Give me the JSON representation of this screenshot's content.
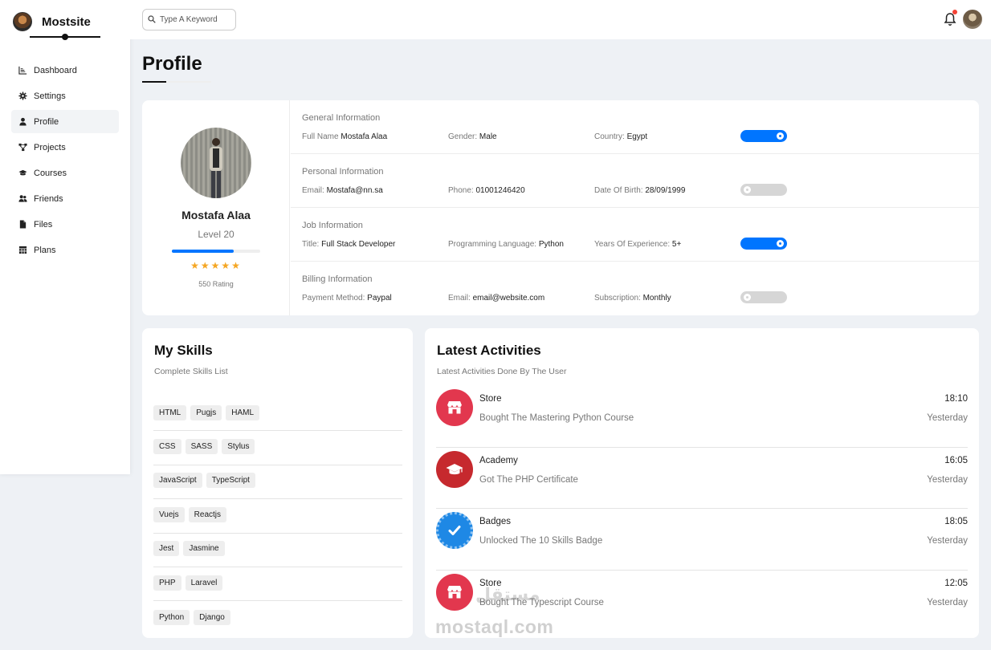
{
  "colors": {
    "accent": "#0075ff",
    "star": "#f5a623",
    "store_red": "#e2374e",
    "academy_red": "#c6292e",
    "badge_blue": "#1e88e5",
    "notification": "#f44336"
  },
  "brand": {
    "name": "Mostsite"
  },
  "sidebar": {
    "items": [
      {
        "label": "Dashboard",
        "icon": "chart-line-icon"
      },
      {
        "label": "Settings",
        "icon": "gear-icon"
      },
      {
        "label": "Profile",
        "icon": "user-icon"
      },
      {
        "label": "Projects",
        "icon": "diagram-project-icon"
      },
      {
        "label": "Courses",
        "icon": "graduation-cap-icon"
      },
      {
        "label": "Friends",
        "icon": "users-icon"
      },
      {
        "label": "Files",
        "icon": "file-icon"
      },
      {
        "label": "Plans",
        "icon": "table-icon"
      }
    ],
    "active": "Profile"
  },
  "header": {
    "search_placeholder": "Type A Keyword"
  },
  "page": {
    "title": "Profile"
  },
  "profile": {
    "name": "Mostafa Alaa",
    "level": "Level 20",
    "level_progress": 0.7,
    "stars": 5,
    "rating": "550 Rating",
    "sections": [
      {
        "title": "General Information",
        "fields": [
          {
            "label": "Full Name",
            "value": "Mostafa Alaa"
          },
          {
            "label": "Gender:",
            "value": "Male"
          },
          {
            "label": "Country:",
            "value": "Egypt"
          }
        ],
        "toggle_on": true
      },
      {
        "title": "Personal Information",
        "fields": [
          {
            "label": "Email:",
            "value": "Mostafa@nn.sa"
          },
          {
            "label": "Phone:",
            "value": "01001246420"
          },
          {
            "label": "Date Of Birth:",
            "value": "28/09/1999"
          }
        ],
        "toggle_on": false
      },
      {
        "title": "Job Information",
        "fields": [
          {
            "label": "Title:",
            "value": "Full Stack Developer"
          },
          {
            "label": "Programming Language:",
            "value": "Python"
          },
          {
            "label": "Years Of Experience:",
            "value": "5+"
          }
        ],
        "toggle_on": true
      },
      {
        "title": "Billing Information",
        "fields": [
          {
            "label": "Payment Method:",
            "value": "Paypal"
          },
          {
            "label": "Email:",
            "value": "email@website.com"
          },
          {
            "label": "Subscription:",
            "value": "Monthly"
          }
        ],
        "toggle_on": false
      }
    ]
  },
  "skills": {
    "title": "My Skills",
    "subtitle": "Complete Skills List",
    "rows": [
      [
        "HTML",
        "Pugjs",
        "HAML"
      ],
      [
        "CSS",
        "SASS",
        "Stylus"
      ],
      [
        "JavaScript",
        "TypeScript"
      ],
      [
        "Vuejs",
        "Reactjs"
      ],
      [
        "Jest",
        "Jasmine"
      ],
      [
        "PHP",
        "Laravel"
      ],
      [
        "Python",
        "Django"
      ]
    ]
  },
  "activities": {
    "title": "Latest Activities",
    "subtitle": "Latest Activities Done By The User",
    "items": [
      {
        "title": "Store",
        "desc": "Bought The Mastering Python Course",
        "time": "18:10",
        "day": "Yesterday",
        "icon": "store-icon"
      },
      {
        "title": "Academy",
        "desc": "Got The PHP Certificate",
        "time": "16:05",
        "day": "Yesterday",
        "icon": "graduation-cap-icon"
      },
      {
        "title": "Badges",
        "desc": "Unlocked The 10 Skills Badge",
        "time": "18:05",
        "day": "Yesterday",
        "icon": "badge-check-icon"
      },
      {
        "title": "Store",
        "desc": "Bought The Typescript Course",
        "time": "12:05",
        "day": "Yesterday",
        "icon": "store-icon"
      }
    ]
  },
  "watermark": {
    "text": "mostaql.com",
    "arabic": "مستقل"
  }
}
